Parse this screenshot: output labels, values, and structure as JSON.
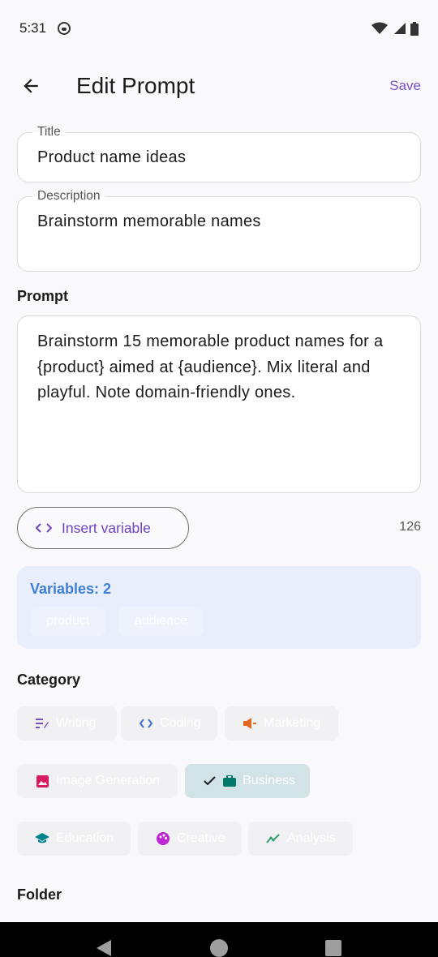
{
  "status": {
    "time": "5:31"
  },
  "header": {
    "title": "Edit Prompt",
    "save_label": "Save"
  },
  "title_field": {
    "label": "Title",
    "value": "Product name ideas"
  },
  "description_field": {
    "label": "Description",
    "value": "Brainstorm memorable names"
  },
  "prompt": {
    "label": "Prompt",
    "text": "Brainstorm 15 memorable product names for a {product} aimed at {audience}. Mix literal and playful. Note domain-friendly ones.",
    "char_count": "126"
  },
  "insert_variable": {
    "label": "Insert variable"
  },
  "variables": {
    "title": "Variables: 2",
    "items": [
      "product",
      "audience"
    ]
  },
  "category": {
    "label": "Category",
    "chips": [
      {
        "label": "Writing",
        "icon": "writing-icon",
        "color": "#7b4fc4",
        "selected": false
      },
      {
        "label": "Coding",
        "icon": "code-icon",
        "color": "#3f6fd0",
        "selected": false
      },
      {
        "label": "Marketing",
        "icon": "megaphone-icon",
        "color": "#e0681f",
        "selected": false
      },
      {
        "label": "Image Generation",
        "icon": "image-icon",
        "color": "#d81b60",
        "selected": false
      },
      {
        "label": "Business",
        "icon": "briefcase-icon",
        "color": "#00796b",
        "selected": true
      },
      {
        "label": "Education",
        "icon": "school-icon",
        "color": "#00838f",
        "selected": false
      },
      {
        "label": "Creative",
        "icon": "palette-icon",
        "color": "#c026d3",
        "selected": false
      },
      {
        "label": "Analysis",
        "icon": "analytics-icon",
        "color": "#2e9e6a",
        "selected": false
      }
    ]
  },
  "folder": {
    "label": "Folder"
  }
}
